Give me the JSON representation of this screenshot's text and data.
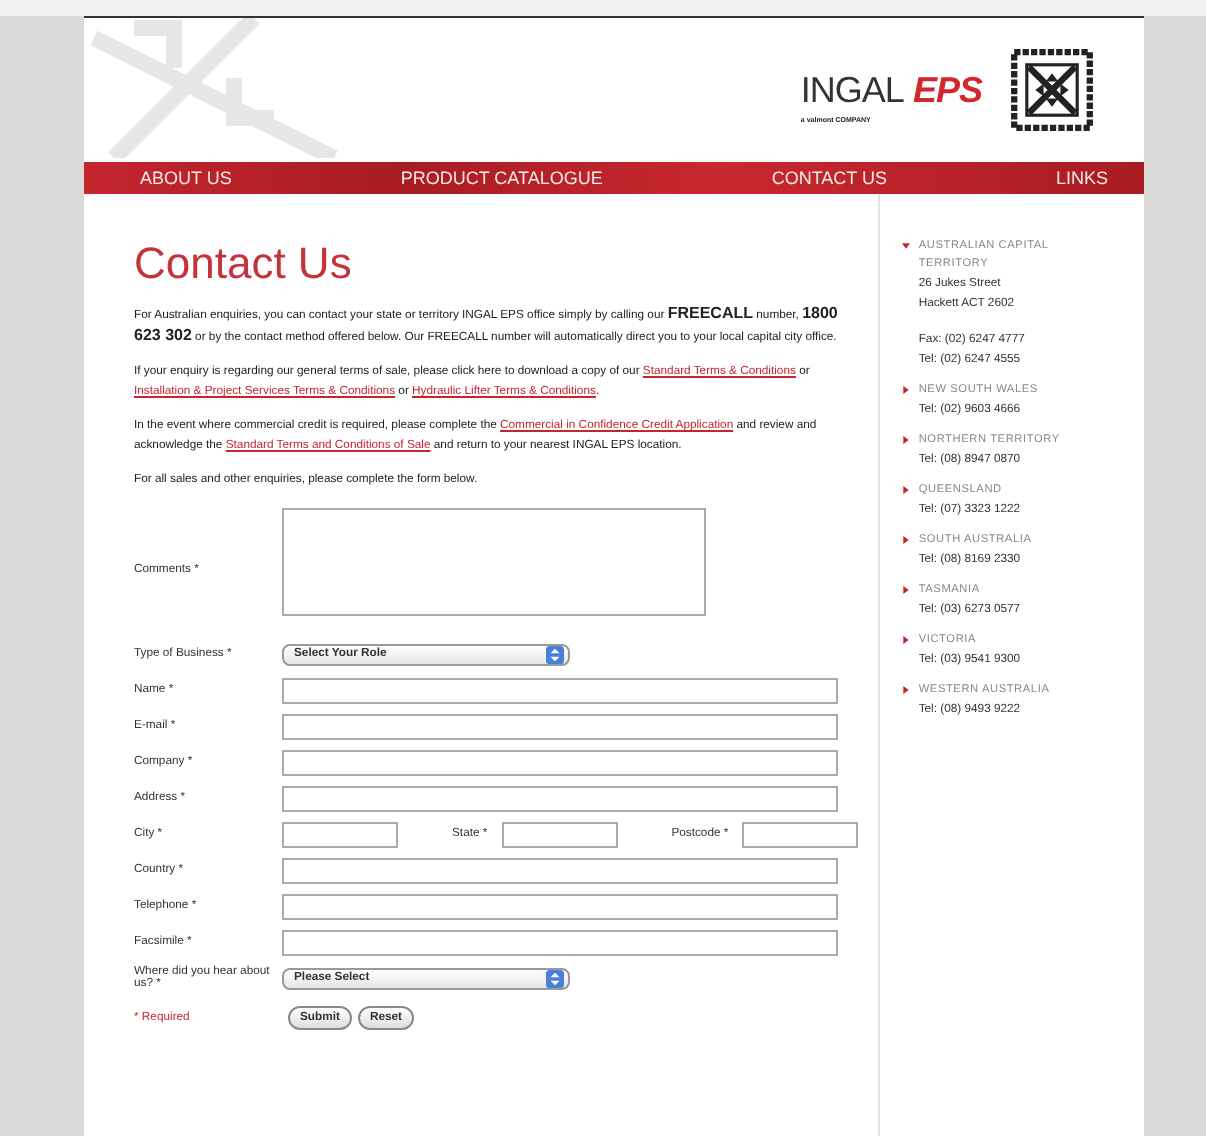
{
  "header": {
    "logo": {
      "brand": "INGAL",
      "accent": "EPS",
      "tagline": "a valmont COMPANY"
    }
  },
  "nav": [
    {
      "label": "ABOUT US"
    },
    {
      "label": "PRODUCT CATALOGUE"
    },
    {
      "label": "CONTACT US"
    },
    {
      "label": "LINKS"
    }
  ],
  "heading": "Contact Us",
  "paragraphs": [
    [
      {
        "kind": "text",
        "text": "For Australian enquiries, you can contact your state or territory INGAL EPS office simply by calling our **FREECALL** number, **1800 623 302** or by the contact method offered below. Our FREECALL number will automatically direct you to your local capital city office."
      }
    ],
    [
      {
        "kind": "text",
        "text": "If your enquiry is regarding our general terms of sale, please click here to download a copy of our "
      },
      {
        "kind": "link",
        "text": "Standard Terms & Conditions"
      },
      {
        "kind": "text",
        "text": " or "
      },
      {
        "kind": "link",
        "text": "Installation & Project Services Terms & Conditions"
      },
      {
        "kind": "text",
        "text": " or "
      },
      {
        "kind": "link",
        "text": "Hydraulic Lifter Terms & Conditions"
      },
      {
        "kind": "text",
        "text": "."
      }
    ],
    [
      {
        "kind": "text",
        "text": "In the event where commercial credit is required, please complete the "
      },
      {
        "kind": "link",
        "text": "Commercial in Confidence Credit Application"
      },
      {
        "kind": "text",
        "text": " and review and acknowledge the "
      },
      {
        "kind": "link",
        "text": "Standard Terms and Conditions of Sale"
      },
      {
        "kind": "text",
        "text": " and return to your nearest INGAL EPS location."
      }
    ],
    [
      {
        "kind": "text",
        "text": "For all sales and other enquiries, please complete the form below."
      }
    ]
  ],
  "form": {
    "rows": [
      {
        "kind": "textarea",
        "fields": [
          {
            "label": "Comments *"
          }
        ]
      },
      {
        "kind": "select",
        "fields": [
          {
            "label": "Type of Business *",
            "value": "Select Your Role"
          }
        ]
      },
      {
        "kind": "input",
        "fields": [
          {
            "label": "Name *"
          }
        ]
      },
      {
        "kind": "input",
        "fields": [
          {
            "label": "E-mail *"
          }
        ]
      },
      {
        "kind": "input",
        "fields": [
          {
            "label": "Company *"
          }
        ]
      },
      {
        "kind": "input",
        "fields": [
          {
            "label": "Address *"
          }
        ]
      },
      {
        "kind": "inline",
        "fields": [
          {
            "label": "City *"
          },
          {
            "label": "State *"
          },
          {
            "label": "Postcode *"
          }
        ]
      },
      {
        "kind": "input",
        "fields": [
          {
            "label": "Country *"
          }
        ]
      },
      {
        "kind": "input",
        "fields": [
          {
            "label": "Telephone *"
          }
        ]
      },
      {
        "kind": "input",
        "fields": [
          {
            "label": "Facsimile *"
          }
        ]
      },
      {
        "kind": "select",
        "fields": [
          {
            "label": "Where did you hear about us? *",
            "value": "Please Select"
          }
        ]
      }
    ],
    "required_note": "* Required",
    "buttons": [
      "Submit",
      "Reset"
    ]
  },
  "offices": [
    {
      "name": "AUSTRALIAN CAPITAL TERRITORY",
      "expanded": true,
      "lines": [
        "26 Jukes Street",
        "Hackett ACT 2602",
        "Fax: (02) 6247 4777",
        "Tel: (02) 6247 4555"
      ]
    },
    {
      "name": "NEW SOUTH WALES",
      "expanded": false,
      "lines": [
        "Tel: (02) 9603 4666"
      ]
    },
    {
      "name": "NORTHERN TERRITORY",
      "expanded": false,
      "lines": [
        "Tel: (08) 8947 0870"
      ]
    },
    {
      "name": "QUEENSLAND",
      "expanded": false,
      "lines": [
        "Tel: (07) 3323 1222"
      ]
    },
    {
      "name": "SOUTH AUSTRALIA",
      "expanded": false,
      "lines": [
        "Tel: (08) 8169 2330"
      ]
    },
    {
      "name": "TASMANIA",
      "expanded": false,
      "lines": [
        "Tel: (03) 6273 0577"
      ]
    },
    {
      "name": "VICTORIA",
      "expanded": false,
      "lines": [
        "Tel: (03) 9541 9300"
      ]
    },
    {
      "name": "WESTERN AUSTRALIA",
      "expanded": false,
      "lines": [
        "Tel: (08) 9493 9222"
      ]
    }
  ]
}
